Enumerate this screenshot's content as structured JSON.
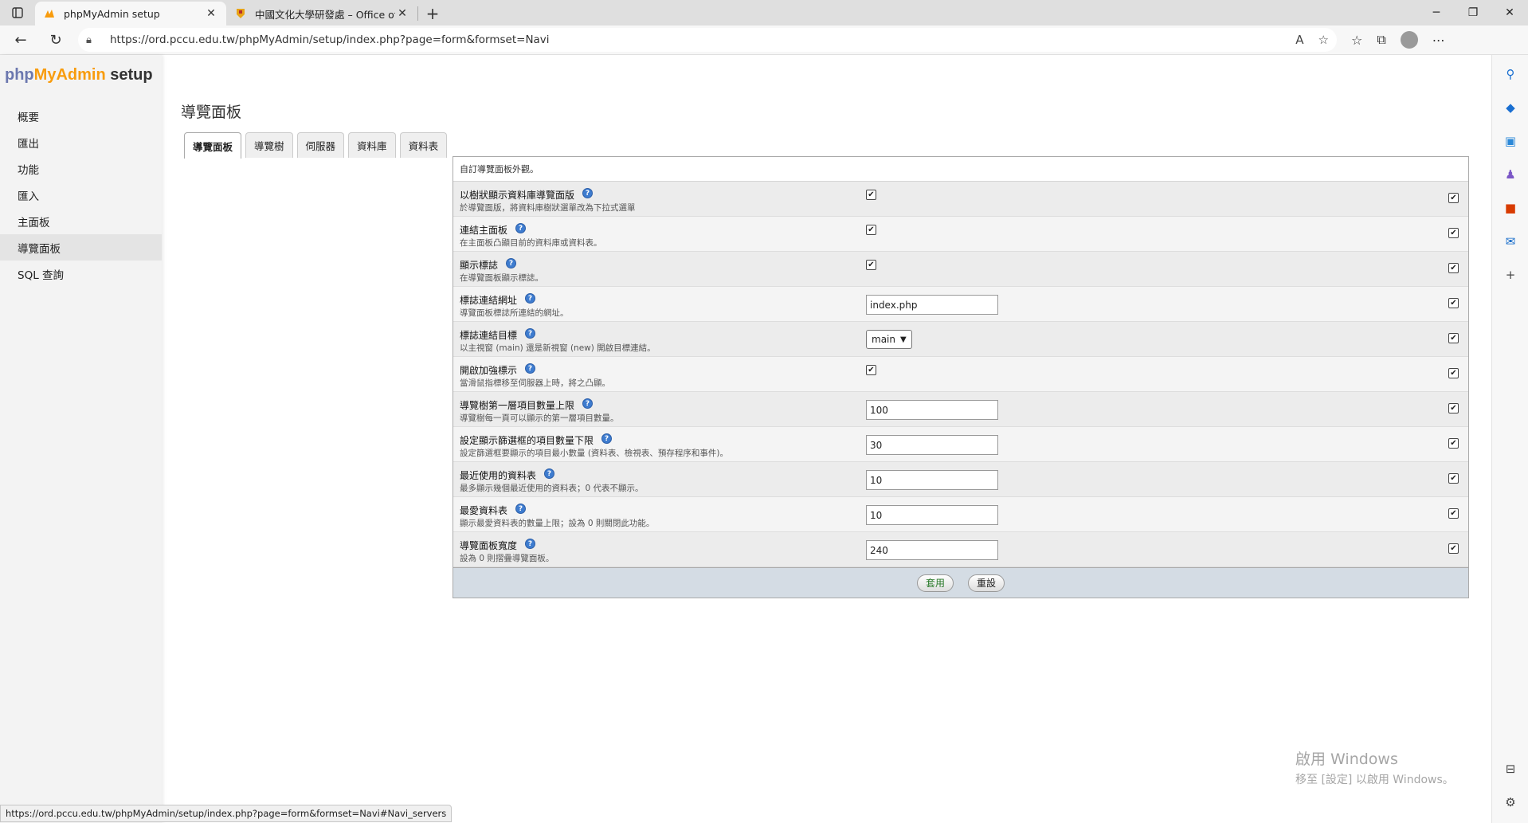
{
  "browser": {
    "tabs": [
      {
        "title": "phpMyAdmin setup",
        "active": true
      },
      {
        "title": "中國文化大學研發處 – Office of",
        "active": false
      }
    ],
    "new_tab": "+",
    "url": "https://ord.pccu.edu.tw/phpMyAdmin/setup/index.php?page=form&formset=Navi",
    "status_url": "https://ord.pccu.edu.tw/phpMyAdmin/setup/index.php?page=form&formset=Navi#Navi_servers"
  },
  "logo": {
    "part1": "php",
    "part2": "MyAdmin",
    "part3": " setup"
  },
  "menu": [
    "概要",
    "匯出",
    "功能",
    "匯入",
    "主面板",
    "導覽面板",
    "SQL 查詢"
  ],
  "active_menu_index": 5,
  "page_title": "導覽面板",
  "form_tabs": [
    "導覽面板",
    "導覽樹",
    "伺服器",
    "資料庫",
    "資料表"
  ],
  "legend": "自訂導覽面板外觀。",
  "help_glyph": "?",
  "rows": [
    {
      "label": "以樹狀顯示資料庫導覽面版",
      "desc": "於導覽面版，將資料庫樹狀選單改為下拉式選單",
      "type": "checkbox",
      "checked": true
    },
    {
      "label": "連結主面板",
      "desc": "在主面板凸顯目前的資料庫或資料表。",
      "type": "checkbox",
      "checked": true
    },
    {
      "label": "顯示標誌",
      "desc": "在導覽面板顯示標誌。",
      "type": "checkbox",
      "checked": true
    },
    {
      "label": "標誌連結網址",
      "desc": "導覽面板標誌所連結的網址。",
      "type": "text",
      "value": "index.php"
    },
    {
      "label": "標誌連結目標",
      "desc": "以主視窗 (main) 還是新視窗 (new) 開啟目標連結。",
      "type": "select",
      "value": "main"
    },
    {
      "label": "開啟加強標示",
      "desc": "當滑鼠指標移至伺服器上時，將之凸顯。",
      "type": "checkbox",
      "checked": true
    },
    {
      "label": "導覽樹第一層項目數量上限",
      "desc": "導覽樹每一頁可以顯示的第一層項目數量。",
      "type": "text",
      "value": "100"
    },
    {
      "label": "設定顯示篩選框的項目數量下限",
      "desc": "設定篩選框要顯示的項目最小數量 (資料表、檢視表、預存程序和事件)。",
      "type": "text",
      "value": "30"
    },
    {
      "label": "最近使用的資料表",
      "desc": "最多顯示幾個最近使用的資料表；0 代表不顯示。",
      "type": "text",
      "value": "10"
    },
    {
      "label": "最愛資料表",
      "desc": "顯示最愛資料表的數量上限；設為 0 則關閉此功能。",
      "type": "text",
      "value": "10"
    },
    {
      "label": "導覽面板寬度",
      "desc": "設為 0 則摺疊導覽面板。",
      "type": "text",
      "value": "240"
    }
  ],
  "buttons": {
    "apply": "套用",
    "reset": "重設"
  },
  "watermark": {
    "line1": "啟用 Windows",
    "line2": "移至 [設定] 以啟用 Windows。"
  }
}
